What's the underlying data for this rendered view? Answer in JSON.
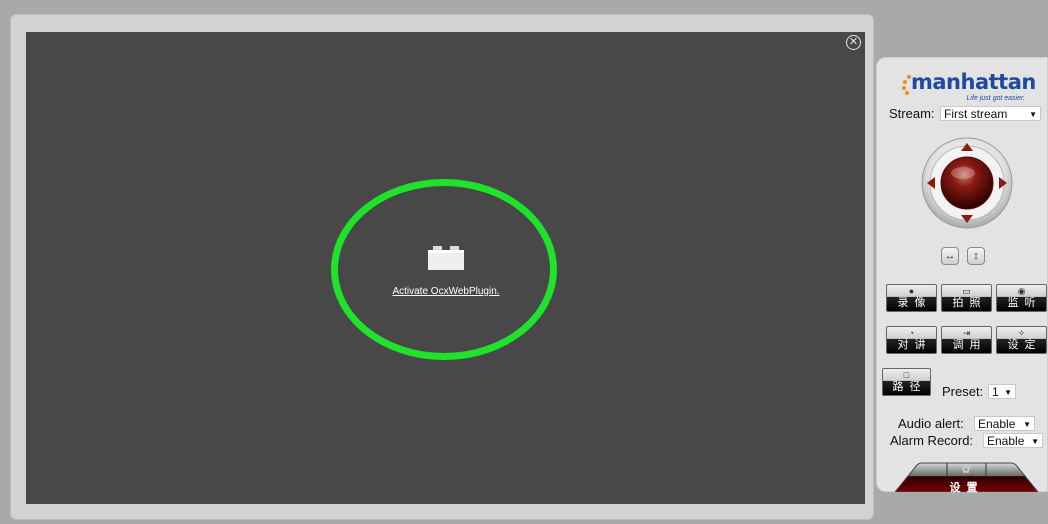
{
  "viewer": {
    "close_icon": "close-icon",
    "plugin_icon": "plugin-block-icon",
    "activate_link": "Activate OcxWebPlugin."
  },
  "panel": {
    "logo": {
      "text": "manhattan",
      "tagline": "Life just got easier."
    },
    "stream": {
      "label": "Stream:",
      "value": "First stream"
    },
    "ptz": {
      "icon": "ptz-joystick-icon"
    },
    "small_buttons": [
      {
        "icon": "horizontal-flip-icon",
        "glyph": "↔"
      },
      {
        "icon": "vertical-flip-icon",
        "glyph": "↕"
      }
    ],
    "buttons": [
      {
        "icon": "record-icon",
        "glyph": "●",
        "label": "录像"
      },
      {
        "icon": "snapshot-icon",
        "glyph": "▭",
        "label": "拍照"
      },
      {
        "icon": "listen-icon",
        "glyph": "◉",
        "label": "监听"
      },
      {
        "icon": "talk-icon",
        "glyph": "◔",
        "label": "对讲"
      },
      {
        "icon": "call-icon",
        "glyph": "⇥",
        "label": "调用"
      },
      {
        "icon": "tools-icon",
        "glyph": "✧",
        "label": "设定"
      }
    ],
    "route_button": {
      "icon": "route-icon",
      "glyph": "□",
      "label": "路径"
    },
    "preset": {
      "label": "Preset:",
      "value": "1"
    },
    "audio_alert": {
      "label": "Audio alert:",
      "value": "Enable"
    },
    "alarm_record": {
      "label": "Alarm Record:",
      "value": "Enable"
    },
    "settings": {
      "icon": "gear-icon",
      "glyph": "✿",
      "label": "设置"
    }
  },
  "colors": {
    "video_bg": "#484848",
    "highlight_ring": "#1ee32a",
    "logo_blue": "#1f4aa0",
    "logo_orange": "#f08a1c"
  }
}
